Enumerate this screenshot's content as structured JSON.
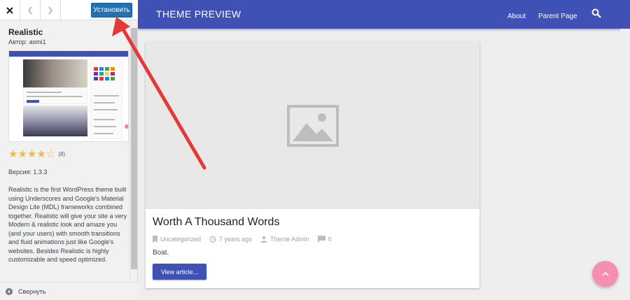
{
  "sidebar": {
    "toolbar": {
      "close_icon": "close-icon",
      "prev_icon": "chevron-left-icon",
      "next_icon": "chevron-right-icon",
      "install_label": "Установить",
      "install_color": "#2271b1"
    },
    "theme": {
      "name": "Realistic",
      "author": "Автор: asmi1",
      "rating": {
        "value": 4,
        "max": 5,
        "count": "(8)"
      },
      "version": "Версия: 1.3.3",
      "description": "Realistic is the first WordPress theme built using Underscores and Google's Material Design Lite (MDL) frameworks combined together. Realistic will give your site a very Modern & realistic look and amaze you (and your users) with smooth transitions and fluid animations just like Google's websites. Besides Realistic is highly customizable and speed optimized."
    },
    "collapse_label": "Свернуть"
  },
  "preview": {
    "site_title": "THEME PREVIEW",
    "nav": [
      {
        "label": "About"
      },
      {
        "label": "Parent Page"
      }
    ],
    "search_icon": "search-icon",
    "primary_color": "#3f51b5",
    "accent_color": "#f48fb1",
    "post": {
      "title": "Worth A Thousand Words",
      "category": "Uncategorized",
      "date": "7 years ago",
      "author": "Theme Admin",
      "comments": "0",
      "excerpt": "Boat.",
      "button_label": "View article..."
    }
  },
  "annotation": {
    "arrow_color": "#e53935"
  }
}
